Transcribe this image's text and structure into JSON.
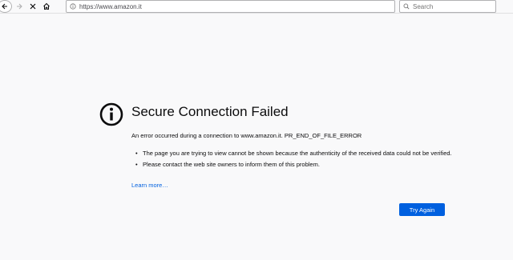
{
  "browser": {
    "url": "https://www.amazon.it",
    "search_placeholder": "Search"
  },
  "error": {
    "title": "Secure Connection Failed",
    "description": "An error occurred during a connection to www.amazon.it. PR_END_OF_FILE_ERROR",
    "bullets": [
      "The page you are trying to view cannot be shown because the authenticity of the received data could not be verified.",
      "Please contact the web site owners to inform them of this problem."
    ],
    "learn_more": "Learn more…",
    "try_again": "Try Again"
  },
  "colors": {
    "accent": "#0060df",
    "background": "#f9f9fa",
    "text": "#0c0c0d"
  }
}
